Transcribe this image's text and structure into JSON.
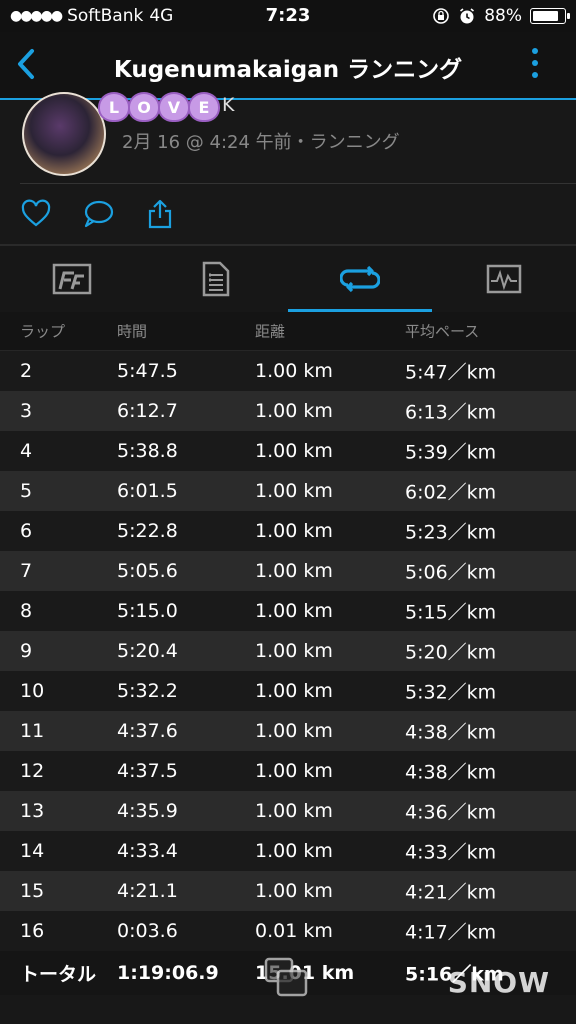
{
  "status_bar": {
    "signal_dots": "●●●●●",
    "carrier": "SoftBank",
    "network": "4G",
    "time": "7:23",
    "battery": "88%",
    "battery_level": 0.88
  },
  "nav": {
    "title": "Kugenumakaigan ランニング",
    "back_icon": "chevron-left-icon",
    "menu_icon": "more-vert-icon",
    "accent": "#1ba0e0"
  },
  "profile": {
    "sticker_letters": [
      "L",
      "O",
      "V",
      "E"
    ],
    "user_name_partial": "K",
    "meta": "2月 16 @ 4:24 午前・ランニング"
  },
  "actions": {
    "like_icon": "heart-outline-icon",
    "comment_icon": "comment-bubble-icon",
    "share_icon": "share-icon"
  },
  "tabs": [
    {
      "icon": "stats-icon"
    },
    {
      "icon": "details-doc-icon"
    },
    {
      "icon": "laps-loop-icon",
      "active": true
    },
    {
      "icon": "chart-graph-icon"
    }
  ],
  "laps": {
    "headers": [
      "ラップ",
      "時間",
      "距離",
      "平均ペース"
    ],
    "rows": [
      [
        "2",
        "5:47.5",
        "1.00 km",
        "5:47／km"
      ],
      [
        "3",
        "6:12.7",
        "1.00 km",
        "6:13／km"
      ],
      [
        "4",
        "5:38.8",
        "1.00 km",
        "5:39／km"
      ],
      [
        "5",
        "6:01.5",
        "1.00 km",
        "6:02／km"
      ],
      [
        "6",
        "5:22.8",
        "1.00 km",
        "5:23／km"
      ],
      [
        "7",
        "5:05.6",
        "1.00 km",
        "5:06／km"
      ],
      [
        "8",
        "5:15.0",
        "1.00 km",
        "5:15／km"
      ],
      [
        "9",
        "5:20.4",
        "1.00 km",
        "5:20／km"
      ],
      [
        "10",
        "5:32.2",
        "1.00 km",
        "5:32／km"
      ],
      [
        "11",
        "4:37.6",
        "1.00 km",
        "4:38／km"
      ],
      [
        "12",
        "4:37.5",
        "1.00 km",
        "4:38／km"
      ],
      [
        "13",
        "4:35.9",
        "1.00 km",
        "4:36／km"
      ],
      [
        "14",
        "4:33.4",
        "1.00 km",
        "4:33／km"
      ],
      [
        "15",
        "4:21.1",
        "1.00 km",
        "4:21／km"
      ],
      [
        "16",
        "0:03.6",
        "0.01 km",
        "4:17／km"
      ]
    ],
    "total": [
      "トータル",
      "1:19:06.9",
      "15.01 km",
      "5:16／km"
    ]
  },
  "watermark": "SNOW"
}
